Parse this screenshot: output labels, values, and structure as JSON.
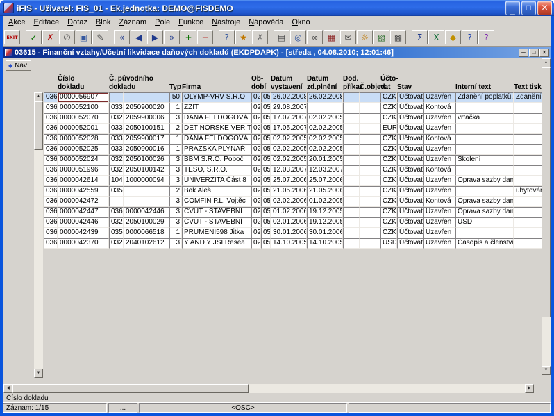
{
  "window": {
    "title": "iFIS - Uživatel: FIS_01 - Ek.jednotka: DEMO@FISDEMO",
    "controls": {
      "minimize": "_",
      "maximize": "□",
      "close": "✕"
    }
  },
  "menu": {
    "items": [
      {
        "name": "menu-akce",
        "label": "Akce"
      },
      {
        "name": "menu-editace",
        "label": "Editace"
      },
      {
        "name": "menu-dotaz",
        "label": "Dotaz"
      },
      {
        "name": "menu-blok",
        "label": "Blok"
      },
      {
        "name": "menu-zaznam",
        "label": "Záznam"
      },
      {
        "name": "menu-pole",
        "label": "Pole"
      },
      {
        "name": "menu-funkce",
        "label": "Funkce"
      },
      {
        "name": "menu-nastroje",
        "label": "Nástroje"
      },
      {
        "name": "menu-napoveda",
        "label": "Nápověda"
      },
      {
        "name": "menu-okno",
        "label": "Okno"
      }
    ]
  },
  "toolbar": {
    "buttons": [
      {
        "name": "exit-button",
        "glyph": "EXIT",
        "color": "#b00000"
      },
      {
        "name": "accept-button",
        "glyph": "✓",
        "color": "#087000"
      },
      {
        "name": "cancel-button",
        "glyph": "✗",
        "color": "#b00000"
      },
      {
        "name": "clear-record-button",
        "glyph": "∅",
        "color": "#444444"
      },
      {
        "name": "duplicate-record-button",
        "glyph": "▣",
        "color": "#35589e"
      },
      {
        "name": "edit-field-button",
        "glyph": "✎",
        "color": "#444444"
      },
      {
        "name": "first-record-button",
        "glyph": "«",
        "color": "#203a8c"
      },
      {
        "name": "previous-record-button",
        "glyph": "◀",
        "color": "#203a8c"
      },
      {
        "name": "next-record-button",
        "glyph": "▶",
        "color": "#203a8c"
      },
      {
        "name": "last-record-button",
        "glyph": "»",
        "color": "#203a8c"
      },
      {
        "name": "insert-record-button",
        "glyph": "+",
        "color": "#087000"
      },
      {
        "name": "delete-record-button",
        "glyph": "−",
        "color": "#b00000"
      },
      {
        "name": "enter-query-button",
        "glyph": "?",
        "color": "#35589e"
      },
      {
        "name": "execute-query-button",
        "glyph": "★",
        "color": "#c07800"
      },
      {
        "name": "cancel-query-button",
        "glyph": "✗",
        "color": "#707070"
      },
      {
        "name": "print-button",
        "glyph": "▤",
        "color": "#444444"
      },
      {
        "name": "zoom-button",
        "glyph": "◎",
        "color": "#35589e"
      },
      {
        "name": "find-button",
        "glyph": "∞",
        "color": "#444444"
      },
      {
        "name": "calendar-button",
        "glyph": "▦",
        "color": "#8a2222"
      },
      {
        "name": "mail-button",
        "glyph": "✉",
        "color": "#444444"
      },
      {
        "name": "alert-button",
        "glyph": "☼",
        "color": "#c07800"
      },
      {
        "name": "attachments-button",
        "glyph": "▧",
        "color": "#2e6e2e"
      },
      {
        "name": "calculator-button",
        "glyph": "▩",
        "color": "#444444"
      },
      {
        "name": "sum-button",
        "glyph": "Σ",
        "color": "#203a8c"
      },
      {
        "name": "excel-export-button",
        "glyph": "X",
        "color": "#0a6b33"
      },
      {
        "name": "lock-button",
        "glyph": "◆",
        "color": "#c09000"
      },
      {
        "name": "help-button",
        "glyph": "?",
        "color": "#1a3fae"
      },
      {
        "name": "about-button",
        "glyph": "?",
        "color": "#7a1fae"
      }
    ]
  },
  "form_window": {
    "title": "03615 - Finanční vztahy/Účetní likvidace daňových dokladů (EKDPDAPK) - [středa , 04.08.2010; 12:01:46]",
    "controls": {
      "minimize": "─",
      "restore": "□",
      "close": "✕"
    },
    "nav_label": "Nav",
    "nav_glyph": "◆"
  },
  "icons": {
    "up": "▲",
    "down": "▼",
    "left": "◀",
    "right": "▶"
  },
  "grid": {
    "headers": {
      "cislo": {
        "l1": "Číslo",
        "l2": "dokladu"
      },
      "puvodni": {
        "l1": "Č. původního",
        "l2": "dokladu"
      },
      "typ": {
        "l1": "",
        "l2": "Typ"
      },
      "firma": {
        "l1": "",
        "l2": "Firma"
      },
      "obdobi": {
        "l1": "Ob-",
        "l2": "dobí"
      },
      "dv": {
        "l1": "Datum",
        "l2": "vystavení"
      },
      "dz": {
        "l1": "Datum",
        "l2": "zd.plnění"
      },
      "dod": {
        "l1": "Dod.",
        "l2": "příkaz"
      },
      "obj": {
        "l1": "",
        "l2": "Č.objed."
      },
      "mena": {
        "l1": "Účto-",
        "l2": "vat"
      },
      "stav": {
        "l1": "",
        "l2": "Stav"
      },
      "uzav": {
        "l1": "",
        "l2": ""
      },
      "itext": {
        "l1": "",
        "l2": "Interní text"
      },
      "ttext": {
        "l1": "",
        "l2": "Text tisku"
      }
    },
    "rows": [
      {
        "pfx": "036",
        "num": "0000056907",
        "opfx": "",
        "onum": "",
        "typ": "50",
        "firma": "OLYMP-VRV S.R.O",
        "ob1": "02",
        "ob2": "05",
        "dv": "26.02.2008",
        "dz": "26.02.2008",
        "dod": "",
        "obj": "",
        "mena": "CZK",
        "stav": "Účtovat",
        "uzav": "Uzavřen",
        "itext": "Zdanění poplatků, příspěv",
        "ttext": "Zdanění a proú"
      },
      {
        "pfx": "036",
        "num": "0000052100",
        "opfx": "033",
        "onum": "2050900020",
        "typ": "1",
        "firma": "ZZIT",
        "ob1": "02",
        "ob2": "05",
        "dv": "29.08.2007",
        "dz": "",
        "dod": "",
        "obj": "",
        "mena": "CZK",
        "stav": "Účtovat",
        "uzav": "Kontová",
        "itext": "",
        "ttext": ""
      },
      {
        "pfx": "036",
        "num": "0000052070",
        "opfx": "032",
        "onum": "2059900006",
        "typ": "3",
        "firma": "DANA FELDOGOVÁ",
        "ob1": "02",
        "ob2": "05",
        "dv": "17.07.2007",
        "dz": "02.02.2005",
        "dod": "",
        "obj": "",
        "mena": "CZK",
        "stav": "Účtovat",
        "uzav": "Uzavřen",
        "itext": "vrtačka",
        "ttext": ""
      },
      {
        "pfx": "036",
        "num": "0000052001",
        "opfx": "033",
        "onum": "2050100151",
        "typ": "2",
        "firma": "DET NORSKE VERIT",
        "ob1": "02",
        "ob2": "05",
        "dv": "17.05.2007",
        "dz": "02.02.2005",
        "dod": "",
        "obj": "",
        "mena": "EUR",
        "stav": "Účtovat",
        "uzav": "Uzavřen",
        "itext": "",
        "ttext": ""
      },
      {
        "pfx": "036",
        "num": "0000052028",
        "opfx": "033",
        "onum": "2059900017",
        "typ": "1",
        "firma": "DANA FELDOGOVÁ",
        "ob1": "02",
        "ob2": "05",
        "dv": "02.02.2005",
        "dz": "02.02.2005",
        "dod": "",
        "obj": "",
        "mena": "CZK",
        "stav": "Účtovat",
        "uzav": "Kontová",
        "itext": "",
        "ttext": ""
      },
      {
        "pfx": "036",
        "num": "0000052025",
        "opfx": "033",
        "onum": "2050900016",
        "typ": "1",
        "firma": "PRAZSKA PLYNAŘ",
        "ob1": "02",
        "ob2": "05",
        "dv": "02.02.2005",
        "dz": "02.02.2005",
        "dod": "",
        "obj": "",
        "mena": "CZK",
        "stav": "Účtovat",
        "uzav": "Uzavřen",
        "itext": "",
        "ttext": ""
      },
      {
        "pfx": "036",
        "num": "0000052024",
        "opfx": "032",
        "onum": "2050100026",
        "typ": "3",
        "firma": "BBM S.R.O. Poboč",
        "ob1": "02",
        "ob2": "05",
        "dv": "02.02.2005",
        "dz": "20.01.2005",
        "dod": "",
        "obj": "",
        "mena": "CZK",
        "stav": "Účtovat",
        "uzav": "Uzavřen",
        "itext": "Skolení",
        "ttext": ""
      },
      {
        "pfx": "036",
        "num": "0000051996",
        "opfx": "032",
        "onum": "2050100142",
        "typ": "3",
        "firma": "TESO, S.R.O.",
        "ob1": "02",
        "ob2": "05",
        "dv": "12.03.2007",
        "dz": "12.03.2007",
        "dod": "",
        "obj": "",
        "mena": "CZK",
        "stav": "Účtovat",
        "uzav": "Kontová",
        "itext": "",
        "ttext": ""
      },
      {
        "pfx": "036",
        "num": "0000042614",
        "opfx": "104",
        "onum": "1000000094",
        "typ": "3",
        "firma": "UNIVERZITA Část 8",
        "ob1": "02",
        "ob2": "05",
        "dv": "25.07.2006",
        "dz": "25.07.2006",
        "dod": "",
        "obj": "",
        "mena": "CZK",
        "stav": "Účtovat",
        "uzav": "Uzavřen",
        "itext": "Oprava sazby daně",
        "ttext": ""
      },
      {
        "pfx": "036",
        "num": "0000042559",
        "opfx": "035",
        "onum": "",
        "typ": "2",
        "firma": "Bok Aleš",
        "ob1": "02",
        "ob2": "05",
        "dv": "21.05.2006",
        "dz": "21.05.2006",
        "dod": "",
        "obj": "",
        "mena": "CZK",
        "stav": "Účtovat",
        "uzav": "Uzavřen",
        "itext": "",
        "ttext": "ubytování hostů"
      },
      {
        "pfx": "036",
        "num": "0000042472",
        "opfx": "",
        "onum": "",
        "typ": "3",
        "firma": "COMFIN P.L. Vojtěc",
        "ob1": "02",
        "ob2": "05",
        "dv": "02.02.2006",
        "dz": "01.02.2005",
        "dod": "",
        "obj": "",
        "mena": "CZK",
        "stav": "Účtovat",
        "uzav": "Kontová",
        "itext": "Oprava sazby daně",
        "ttext": ""
      },
      {
        "pfx": "036",
        "num": "0000042447",
        "opfx": "036",
        "onum": "0000042446",
        "typ": "3",
        "firma": "ČVUT - STAVEBNÍ",
        "ob1": "02",
        "ob2": "05",
        "dv": "01.02.2006",
        "dz": "19.12.2005",
        "dod": "",
        "obj": "",
        "mena": "CZK",
        "stav": "Účtovat",
        "uzav": "Uzavřen",
        "itext": "Oprava sazby daně",
        "ttext": ""
      },
      {
        "pfx": "036",
        "num": "0000042446",
        "opfx": "032",
        "onum": "2050100029",
        "typ": "3",
        "firma": "ČVUT - STAVEBNÍ",
        "ob1": "02",
        "ob2": "05",
        "dv": "02.01.2006",
        "dz": "19.12.2005",
        "dod": "",
        "obj": "",
        "mena": "CZK",
        "stav": "Účtovat",
        "uzav": "Uzavřen",
        "itext": "USD",
        "ttext": ""
      },
      {
        "pfx": "036",
        "num": "0000042439",
        "opfx": "035",
        "onum": "0000066518",
        "typ": "1",
        "firma": "PRUMENI598 Jitka",
        "ob1": "02",
        "ob2": "05",
        "dv": "30.01.2006",
        "dz": "30.01.2006",
        "dod": "",
        "obj": "",
        "mena": "CZK",
        "stav": "Účtovat",
        "uzav": "Uzavřen",
        "itext": "",
        "ttext": ""
      },
      {
        "pfx": "036",
        "num": "0000042370",
        "opfx": "032",
        "onum": "2040102612",
        "typ": "3",
        "firma": "Y AND Y JSI Resea",
        "ob1": "02",
        "ob2": "05",
        "dv": "14.10.2005",
        "dz": "14.10.2005",
        "dod": "",
        "obj": "",
        "mena": "USD",
        "stav": "Účtovat",
        "uzav": "Uzavřen",
        "itext": "Časopis a členství",
        "ttext": ""
      }
    ]
  },
  "statusbar": {
    "hint": "Číslo dokladu",
    "record": "Záznam: 1/15",
    "dots": "...",
    "osc": "<OSC>"
  }
}
